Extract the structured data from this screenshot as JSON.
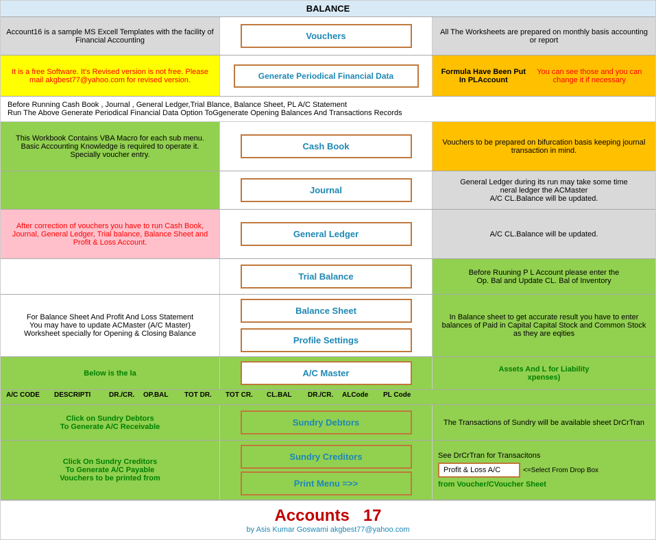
{
  "header": {
    "balance_label": "BALANCE"
  },
  "row_vouchers": {
    "left_text": "Account16 is a sample MS Excell Templates with the facility of Financial Accounting",
    "button_label": "Vouchers",
    "right_text": "All The Worksheets are prepared on monthly basis accounting or report"
  },
  "row_generate": {
    "left_text": "It is a free Software. It's Revised version is not free.  Please mail akgbest77@yahoo.com for revised version.",
    "button_label": "Generate Periodical Financial Data",
    "right_text_line1": "Formula Have Been Put In PLAccount",
    "right_text_line2": "You can see those and you can change it if necessary"
  },
  "info_row": {
    "line1": "Before Running Cash Book , Journal , General Ledger,Trial Blance, Balance Sheet, PL A/C Statement",
    "line2": "Run The Above Generate Periodical Financial Data Option ToGgenerate Opening Balances And Transactions Records"
  },
  "row_cashbook": {
    "left_text": "This Workbook Contains VBA Macro for each sub menu. Basic Accounting Knowledge is required to operate it. Specially voucher entry.",
    "button_label": "Cash Book",
    "right_text": "Vouchers to be prepared on bifurcation basis keeping journal transaction in mind."
  },
  "row_journal": {
    "button_label": "Journal",
    "right_text_line1": "General Ledger during its run may take some time",
    "right_text_line2": "neral ledger the ACMaster",
    "right_text_line3": "A/C CL.Balance will be updated."
  },
  "row_gl": {
    "left_text": "After correction of vouchers you have to run Cash Book, Journal, General Ledger, Trial balance, Balance Sheet and Profit & Loss Account.",
    "button_label": "General Ledger",
    "right_text_line1": "A/C CL.Balance will be updated."
  },
  "row_tb": {
    "button_label": "Trial Balance",
    "right_text_line1": "Before Ruuning P L Account please enter the",
    "right_text_line2": "Op. Bal and Update CL. Bal of Inventory"
  },
  "row_bs": {
    "left_text_line1": "For Balance Sheet And Profit And Loss Statement",
    "left_text_line2": "You may have to update ACMaster (A/C Master)",
    "left_text_line3": "Worksheet specially for Opening & Closing Balance",
    "button_label": "Balance Sheet",
    "right_text": "In Balance sheet to get accurate result you have to enter balances of Paid in Capital Capital Stock and Common Stock as they are eqities"
  },
  "row_ps": {
    "button_label": "Profile Settings"
  },
  "acmaster_section": {
    "header_left": "Below is the la",
    "header_right": "Assets And L for Liability",
    "header_right2": "xpenses)",
    "button_label": "A/C Master",
    "columns": [
      "A/C CODE",
      "DESCRIPTI",
      "DR./CR.",
      "OP.BAL",
      "TOT DR.",
      "TOT CR.",
      "CL.BAL",
      "DR./CR.",
      "ALCode",
      "PL Code"
    ]
  },
  "row_sd": {
    "left_line1": "Click on Sundry Debtors",
    "left_line2": "To Generate A/C Receivable",
    "button_label": "Sundry Debtors",
    "right_text": "The Transactions of Sundry will be available sheet DrCrTran"
  },
  "row_sc": {
    "left_line1": "Click On Sundry Creditors",
    "left_line2": "To Generate A/C Payable",
    "left_line3": "Vouchers to be printed from",
    "button_label": "Sundry Creditors",
    "right_line1": "See DrCrTran for Transacitons",
    "pl_input_value": "Profit & Loss A/C",
    "select_text": "<=Select From Drop Box",
    "right_line3": "from Voucher/CVoucher Sheet"
  },
  "row_pm": {
    "button_label": "Print Menu =>>"
  },
  "footer": {
    "title": "Accounts",
    "number": "17",
    "sub_line": "by Asis Kumar Goswami     akgbest77@yahoo.com"
  }
}
